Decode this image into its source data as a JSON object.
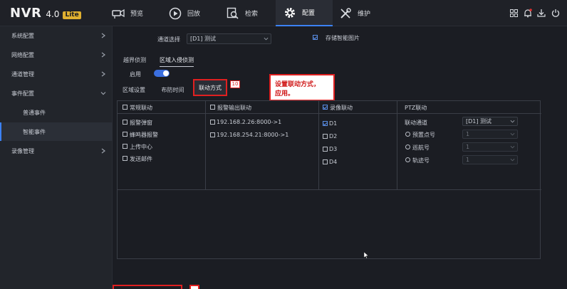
{
  "app": {
    "name": "NVR",
    "version": "4.0",
    "edition": "Lite"
  },
  "nav": [
    {
      "label": "预览",
      "icon": "camera-icon"
    },
    {
      "label": "回放",
      "icon": "playback-icon"
    },
    {
      "label": "检索",
      "icon": "search-icon"
    },
    {
      "label": "配置",
      "icon": "gear-icon",
      "active": true
    },
    {
      "label": "维护",
      "icon": "tools-icon"
    }
  ],
  "topright_icons": [
    "grid-icon",
    "bell-icon",
    "download-icon",
    "power-icon"
  ],
  "sidebar": {
    "items": [
      {
        "label": "系统配置"
      },
      {
        "label": "网络配置"
      },
      {
        "label": "通道管理"
      },
      {
        "label": "事件配置"
      },
      {
        "label": "普通事件"
      },
      {
        "label": "智能事件",
        "active": true
      },
      {
        "label": "录像管理"
      }
    ]
  },
  "channel": {
    "label": "通道选择",
    "value": "[D1] 测试"
  },
  "store_picture": {
    "label": "存储智能图片",
    "checked": true
  },
  "tabs1": [
    {
      "label": "越界侦测"
    },
    {
      "label": "区域入侵侦测",
      "active": true
    }
  ],
  "enable": {
    "label": "启用",
    "on": true
  },
  "tabs2": [
    {
      "label": "区域设置"
    },
    {
      "label": "布防时间"
    },
    {
      "label": "联动方式",
      "active": true
    }
  ],
  "annotations": {
    "badge_10": "10",
    "callout_line1": "设置联动方式，",
    "callout_line2": "应用。"
  },
  "columns": {
    "normal": {
      "header": "常规联动",
      "items": [
        "报警弹窗",
        "蜂鸣器报警",
        "上传中心",
        "发送邮件"
      ]
    },
    "alarm_out": {
      "header": "报警输出联动",
      "items": [
        "192.168.2.26:8000->1",
        "192.168.254.21:8000->1"
      ]
    },
    "record": {
      "header": "录像联动",
      "header_checked": true,
      "items": [
        {
          "label": "D1",
          "checked": true
        },
        {
          "label": "D2",
          "checked": false
        },
        {
          "label": "D3",
          "checked": false
        },
        {
          "label": "D4",
          "checked": false
        }
      ]
    },
    "ptz": {
      "header": "PTZ联动",
      "channel_label": "联动通道",
      "channel_value": "[D1] 测试",
      "options": [
        {
          "label": "预置点号",
          "value": "1"
        },
        {
          "label": "巡航号",
          "value": "1"
        },
        {
          "label": "轨迹号",
          "value": "1"
        }
      ]
    }
  }
}
